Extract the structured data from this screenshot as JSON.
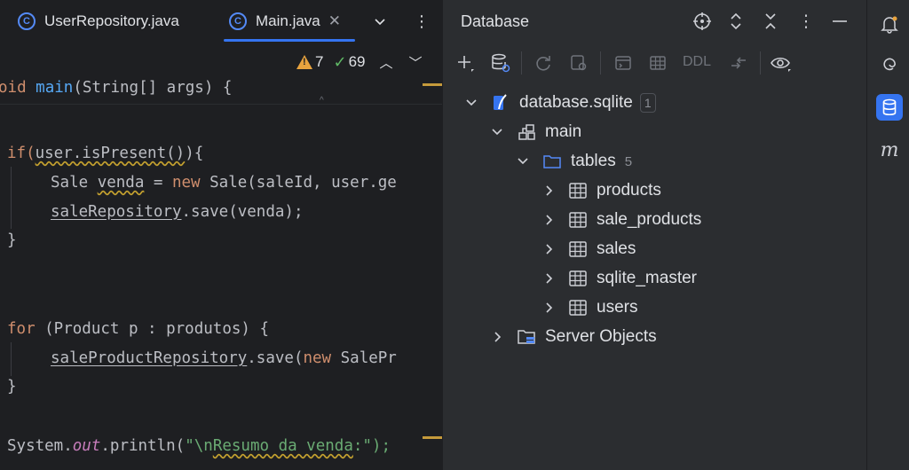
{
  "editor": {
    "tabs": [
      {
        "label": "UserRepository.java",
        "icon": "class-icon"
      },
      {
        "label": "Main.java",
        "icon": "class-icon",
        "active": true
      }
    ],
    "inspection": {
      "warnings": "7",
      "ok": "69"
    },
    "code": {
      "l1": {
        "a": "oid ",
        "b": "main",
        "c": "(String[] args) {"
      },
      "l2": {
        "a": "if(",
        "b": "user.isPresent()",
        "c": "){"
      },
      "l3": {
        "a": "Sale ",
        "b": "venda",
        "c": " = ",
        "d": "new",
        "e": " Sale(saleId, user.ge"
      },
      "l4": {
        "a": "saleRepository",
        "b": ".save(venda);"
      },
      "l5": "}",
      "l6": {
        "a": "for",
        "b": " (Product p : produtos) {"
      },
      "l7": {
        "a": "saleProductRepository",
        "b": ".save(",
        "c": "new",
        "d": " SalePr"
      },
      "l8": "}",
      "l9": {
        "a": "System.",
        "b": "out",
        "c": ".println(",
        "d": "\"\\n",
        "e": "Resumo da venda",
        "f": ":\");"
      }
    }
  },
  "database": {
    "title": "Database",
    "toolbar": {
      "ddl_label": "DDL"
    },
    "tree": {
      "root": {
        "label": "database.sqlite",
        "count": "1"
      },
      "schema": {
        "label": "main"
      },
      "tables_folder": {
        "label": "tables",
        "count": "5"
      },
      "tables": [
        {
          "label": "products"
        },
        {
          "label": "sale_products"
        },
        {
          "label": "sales"
        },
        {
          "label": "sqlite_master"
        },
        {
          "label": "users"
        }
      ],
      "server_objects": {
        "label": "Server Objects"
      }
    }
  },
  "stripe": {
    "m_label": "m"
  },
  "colors": {
    "accent": "#3574f0",
    "keyword": "#cf8e6d",
    "function": "#56a8f5",
    "string": "#6aab73",
    "warning": "#e8a33e"
  }
}
